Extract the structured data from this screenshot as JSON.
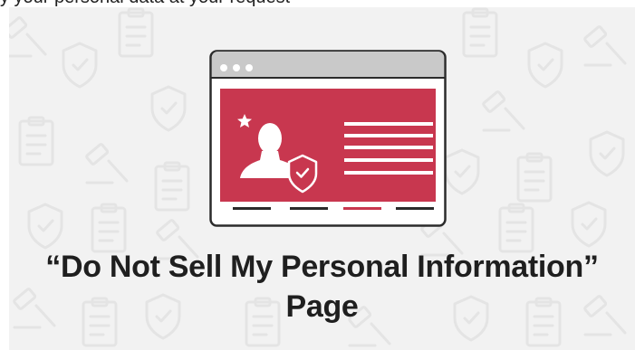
{
  "caption": "y your personal data at your request",
  "headline": {
    "line1": "“Do Not Sell My Personal Information”",
    "line2": "Page"
  },
  "colors": {
    "background": "#f2f2f2",
    "pattern": "#e6e6e6",
    "window_frame": "#2b2b2b",
    "window_titlebar": "#c9c9c9",
    "window_body": "#c8374f",
    "accent_bar": "#c8374f",
    "white": "#ffffff"
  },
  "icons": [
    "browser-window-icon",
    "person-icon",
    "shield-check-icon",
    "star-icon",
    "window-dot-icon",
    "clipboard-icon",
    "gavel-icon"
  ]
}
